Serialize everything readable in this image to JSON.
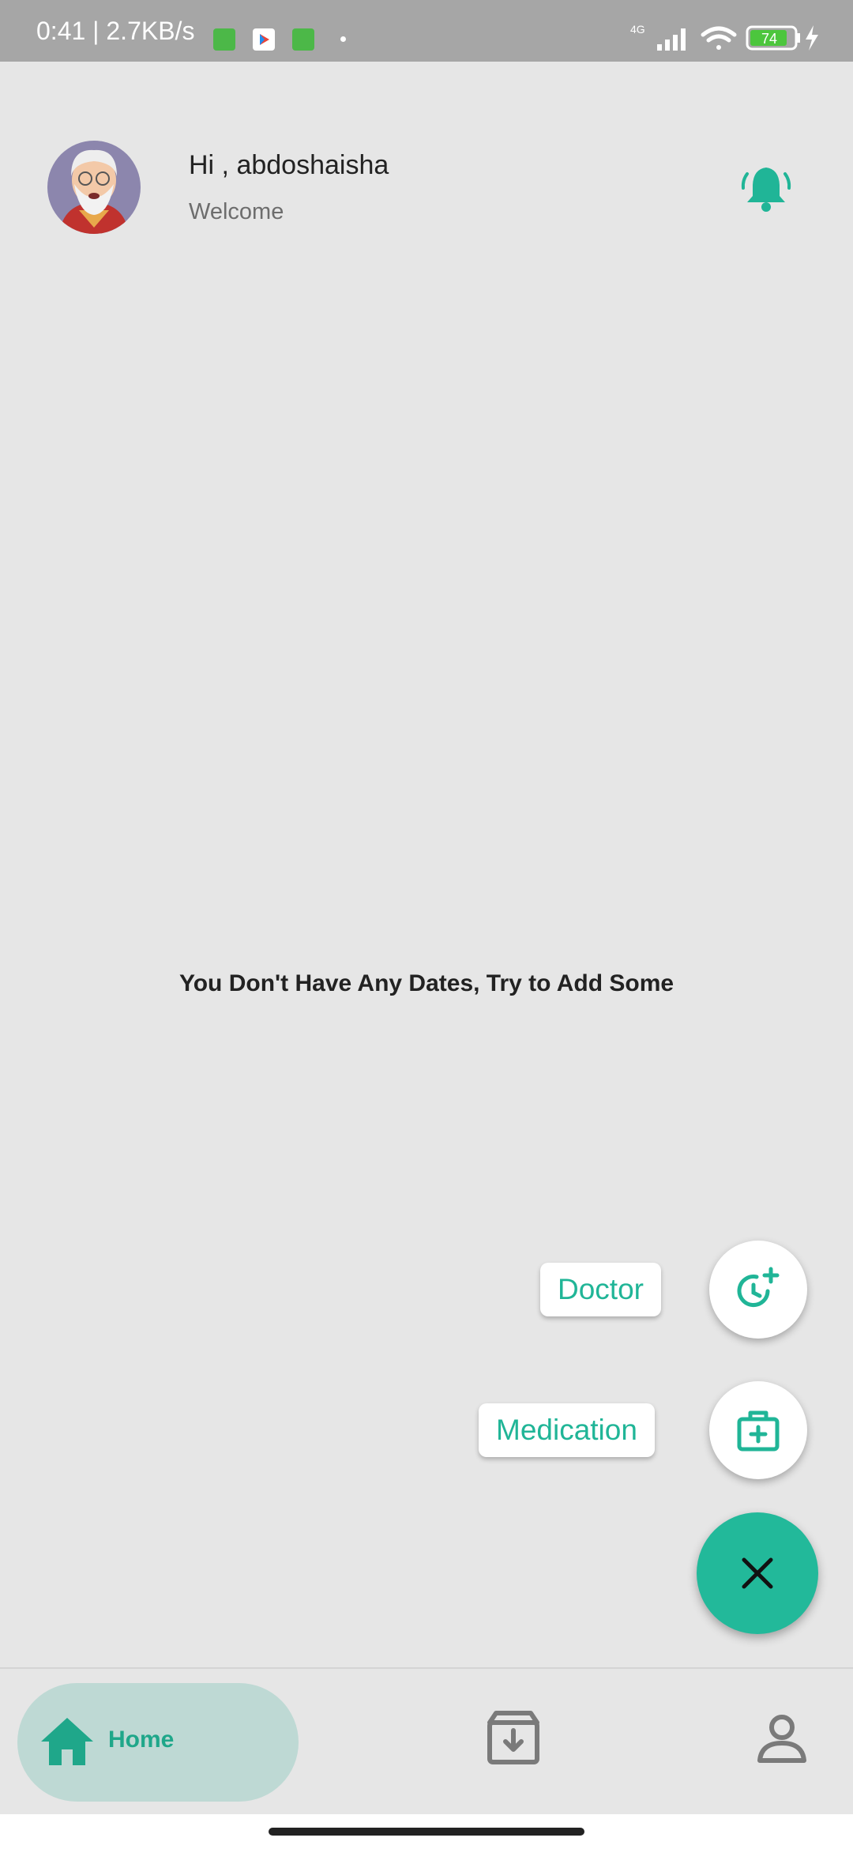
{
  "status_bar": {
    "time_speed": "0:41 | 2.7KB/s",
    "network": "4G",
    "battery": "74"
  },
  "header": {
    "greeting": "Hi , abdoshaisha",
    "subtitle": "Welcome"
  },
  "main": {
    "empty_message": "You Don't Have Any Dates, Try to Add Some"
  },
  "speed_dial": {
    "doctor_label": "Doctor",
    "medication_label": "Medication"
  },
  "bottom_nav": {
    "home_label": "Home"
  },
  "colors": {
    "accent": "#22b99a",
    "background": "#e6e6e6",
    "status_bar": "#a6a6a6"
  },
  "icons": [
    "avatar",
    "bell-ring-icon",
    "clock-plus-icon",
    "medical-kit-icon",
    "close-icon",
    "home-icon",
    "archive-icon",
    "person-icon"
  ]
}
